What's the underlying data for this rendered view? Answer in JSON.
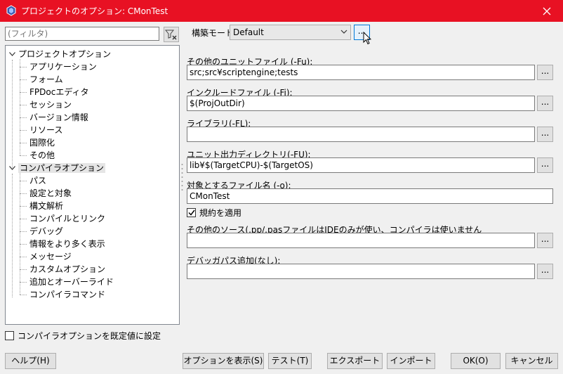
{
  "window": {
    "title": "プロジェクトのオプション: CMonTest"
  },
  "filter": {
    "placeholder": "(フィルタ)"
  },
  "tree": {
    "project_options": {
      "label": "プロジェクトオプション",
      "children": [
        "アプリケーション",
        "フォーム",
        "FPDocエディタ",
        "セッション",
        "バージョン情報",
        "リソース",
        "国際化",
        "その他"
      ]
    },
    "compiler_options": {
      "label": "コンパイラオプション",
      "children": [
        "パス",
        "設定と対象",
        "構文解析",
        "コンパイルとリンク",
        "デバッグ",
        "情報をより多く表示",
        "メッセージ",
        "カスタムオプション",
        "追加とオーバーライド",
        "コンパイラコマンド"
      ]
    }
  },
  "set_defaults": {
    "label": "コンパイラオプションを既定値に設定",
    "checked": false
  },
  "build_mode": {
    "label": "構築モード",
    "value": "Default",
    "button": "..."
  },
  "fields": [
    {
      "label": "その他のユニットファイル (-Fu):",
      "value": "src;src¥scriptengine;tests",
      "button": "..."
    },
    {
      "label": "インクルードファイル (-Fi):",
      "value": "$(ProjOutDir)",
      "button": "..."
    },
    {
      "label": "ライブラリ(-FL):",
      "value": "",
      "button": "..."
    },
    {
      "label": "ユニット出力ディレクトリ(-FU):",
      "value": "lib¥$(TargetCPU)-$(TargetOS)",
      "button": "..."
    },
    {
      "label": "対象とするファイル名 (-o):",
      "value": "CMonTest"
    },
    {
      "label": "その他のソース(.pp/.pasファイルはIDEのみが使い、コンパイラは使いません",
      "value": "",
      "button": "..."
    },
    {
      "label": "デバッガパス追加(なし):",
      "value": "",
      "button": "..."
    }
  ],
  "apply_conventions": {
    "label": "規約を適用",
    "checked": true
  },
  "buttons": {
    "help": "ヘルプ(H)",
    "show_options": "オプションを表示(S)",
    "test": "テスト(T)",
    "export": "エクスポート",
    "import": "インポート",
    "ok": "OK(O)",
    "cancel": "キャンセル"
  },
  "colors": {
    "titlebar": "#e81123",
    "focus": "#0078d7"
  }
}
